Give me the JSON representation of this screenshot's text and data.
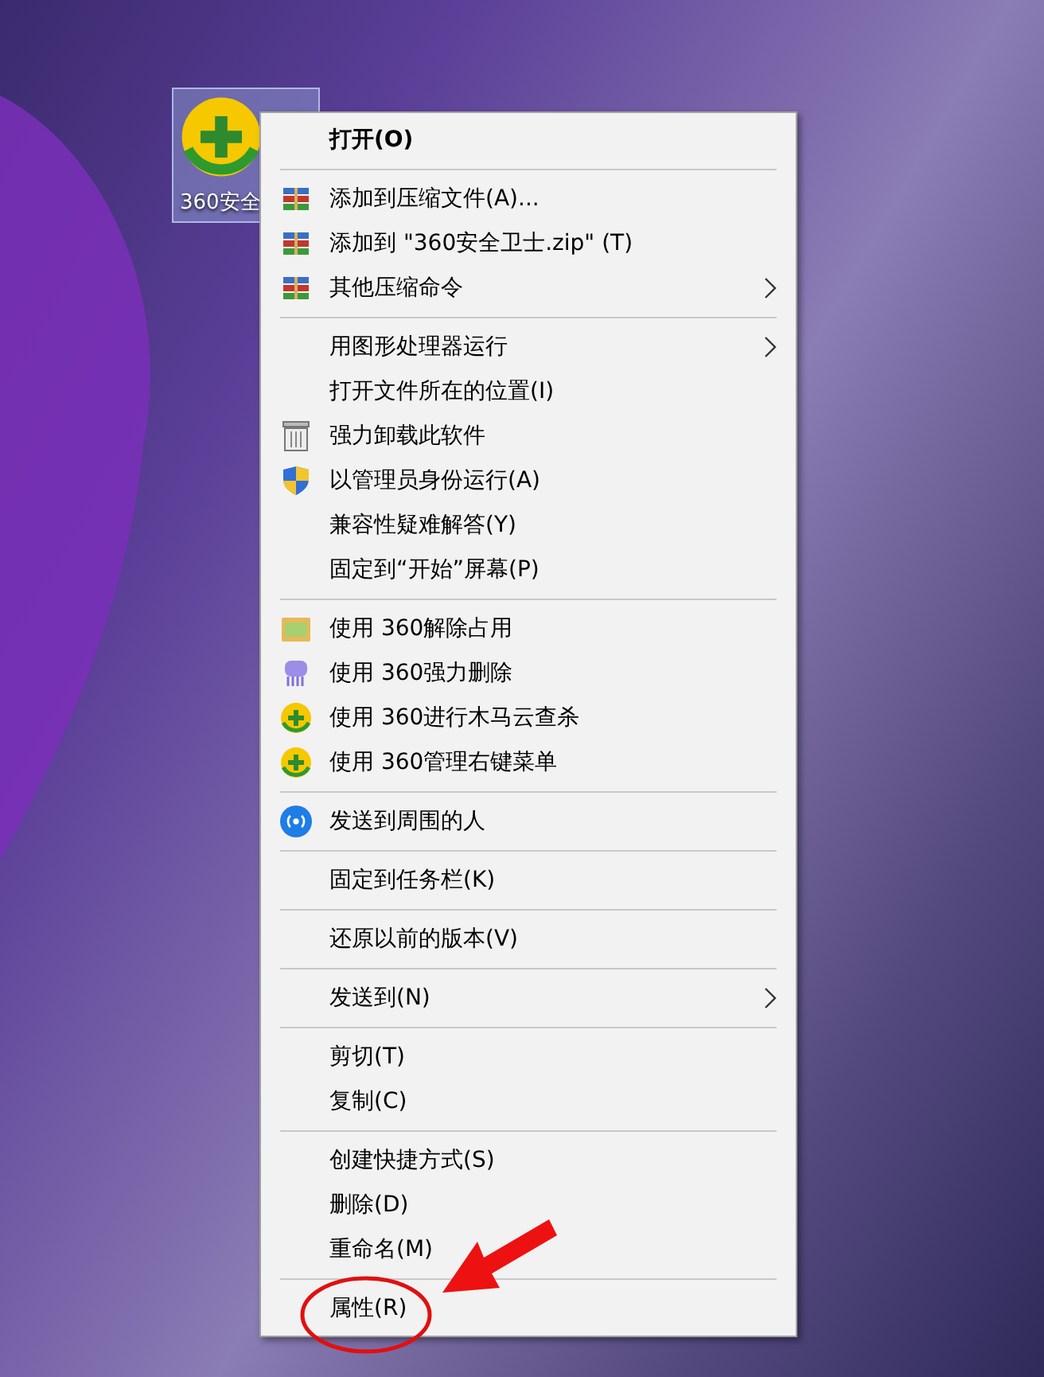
{
  "desktop_icon": {
    "label": "360安全"
  },
  "menu": {
    "groups": [
      {
        "items": [
          {
            "label": "打开(O)",
            "kind": "plain",
            "default": true,
            "submenu": false
          }
        ]
      },
      {
        "items": [
          {
            "label": "添加到压缩文件(A)...",
            "kind": "archive",
            "default": false,
            "submenu": false
          },
          {
            "label": "添加到 \"360安全卫士.zip\" (T)",
            "kind": "archive",
            "default": false,
            "submenu": false
          },
          {
            "label": "其他压缩命令",
            "kind": "archive",
            "default": false,
            "submenu": true
          }
        ]
      },
      {
        "items": [
          {
            "label": "用图形处理器运行",
            "kind": "plain",
            "default": false,
            "submenu": true
          },
          {
            "label": "打开文件所在的位置(I)",
            "kind": "plain",
            "default": false,
            "submenu": false
          },
          {
            "label": "强力卸载此软件",
            "kind": "trash",
            "default": false,
            "submenu": false
          },
          {
            "label": "以管理员身份运行(A)",
            "kind": "shield",
            "default": false,
            "submenu": false
          },
          {
            "label": "兼容性疑难解答(Y)",
            "kind": "plain",
            "default": false,
            "submenu": false
          },
          {
            "label": "固定到“开始”屏幕(P)",
            "kind": "plain",
            "default": false,
            "submenu": false
          }
        ]
      },
      {
        "items": [
          {
            "label": "使用 360解除占用",
            "kind": "unlock",
            "default": false,
            "submenu": false
          },
          {
            "label": "使用 360强力删除",
            "kind": "shredder",
            "default": false,
            "submenu": false
          },
          {
            "label": "使用 360进行木马云查杀",
            "kind": "guard",
            "default": false,
            "submenu": false
          },
          {
            "label": "使用 360管理右键菜单",
            "kind": "guard",
            "default": false,
            "submenu": false
          }
        ]
      },
      {
        "items": [
          {
            "label": "发送到周围的人",
            "kind": "share",
            "default": false,
            "submenu": false
          }
        ]
      },
      {
        "items": [
          {
            "label": "固定到任务栏(K)",
            "kind": "plain",
            "default": false,
            "submenu": false
          }
        ]
      },
      {
        "items": [
          {
            "label": "还原以前的版本(V)",
            "kind": "plain",
            "default": false,
            "submenu": false
          }
        ]
      },
      {
        "items": [
          {
            "label": "发送到(N)",
            "kind": "plain",
            "default": false,
            "submenu": true
          }
        ]
      },
      {
        "items": [
          {
            "label": "剪切(T)",
            "kind": "plain",
            "default": false,
            "submenu": false
          },
          {
            "label": "复制(C)",
            "kind": "plain",
            "default": false,
            "submenu": false
          }
        ]
      },
      {
        "items": [
          {
            "label": "创建快捷方式(S)",
            "kind": "plain",
            "default": false,
            "submenu": false
          },
          {
            "label": "删除(D)",
            "kind": "plain",
            "default": false,
            "submenu": false
          },
          {
            "label": "重命名(M)",
            "kind": "plain",
            "default": false,
            "submenu": false
          }
        ]
      },
      {
        "items": [
          {
            "label": "属性(R)",
            "kind": "plain",
            "default": false,
            "submenu": false
          }
        ]
      }
    ]
  }
}
